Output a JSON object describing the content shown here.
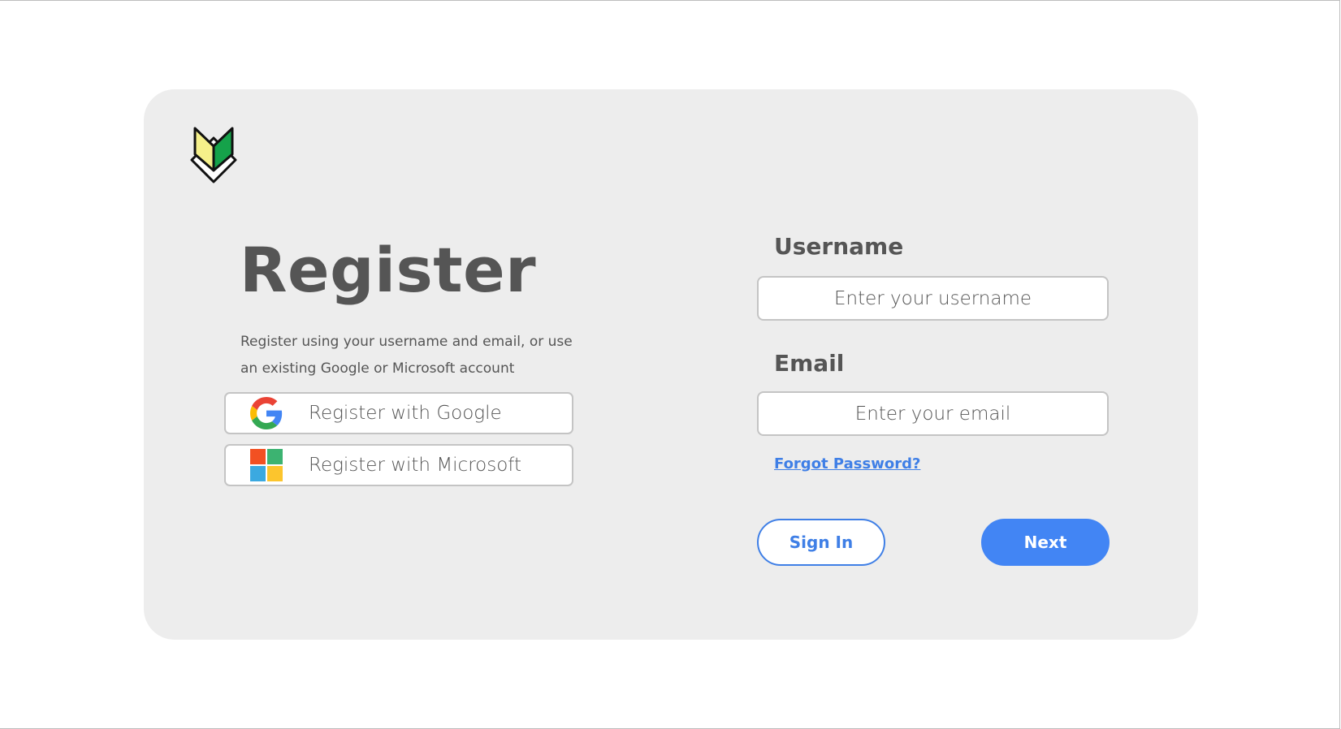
{
  "page": {
    "title": "Register",
    "description": "Register using your username and email, or use an existing Google or Microsoft account"
  },
  "social": {
    "google": {
      "label": "Register with Google",
      "icon": "google-icon"
    },
    "microsoft": {
      "label": "Register with Microsoft",
      "icon": "microsoft-icon"
    }
  },
  "form": {
    "username": {
      "label": "Username",
      "placeholder": "Enter your username",
      "value": ""
    },
    "email": {
      "label": "Email",
      "placeholder": "Enter your email",
      "value": ""
    },
    "forgot_password": "Forgot Password?"
  },
  "actions": {
    "sign_in": "Sign In",
    "next": "Next"
  },
  "colors": {
    "accent": "#4285f4",
    "link": "#3f7fe6",
    "card_background": "#ededed",
    "text": "#555555"
  }
}
